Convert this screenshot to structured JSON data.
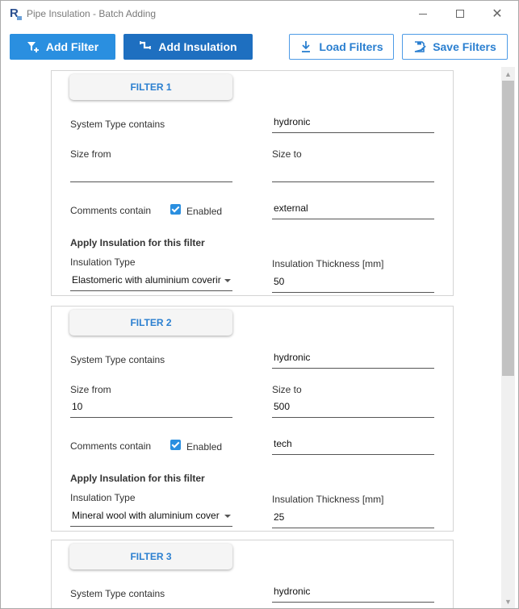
{
  "window": {
    "title": "Pipe Insulation - Batch Adding"
  },
  "toolbar": {
    "add_filter": "Add Filter",
    "add_insulation": "Add Insulation",
    "load_filters": "Load Filters",
    "save_filters": "Save Filters"
  },
  "labels": {
    "system_type": "System Type contains",
    "size_from": "Size from",
    "size_to": "Size to",
    "comments": "Comments contain",
    "enabled": "Enabled",
    "apply": "Apply Insulation for this filter",
    "insulation_type": "Insulation Type",
    "insulation_thickness": "Insulation Thickness [mm]"
  },
  "filters": [
    {
      "title": "FILTER 1",
      "system_type": "hydronic",
      "size_from": "",
      "size_to": "",
      "comments_enabled": true,
      "comments": "external",
      "insulation_type": "Elastomeric with aluminium coverir",
      "thickness": "50"
    },
    {
      "title": "FILTER 2",
      "system_type": "hydronic",
      "size_from": "10",
      "size_to": "500",
      "comments_enabled": true,
      "comments": "tech",
      "insulation_type": "Mineral wool with aluminium cover",
      "thickness": "25"
    },
    {
      "title": "FILTER 3",
      "system_type": "hydronic"
    }
  ],
  "colors": {
    "accent": "#2a8fe0",
    "accent_dark": "#1e6fc0",
    "accent_text": "#2a7fd0"
  }
}
